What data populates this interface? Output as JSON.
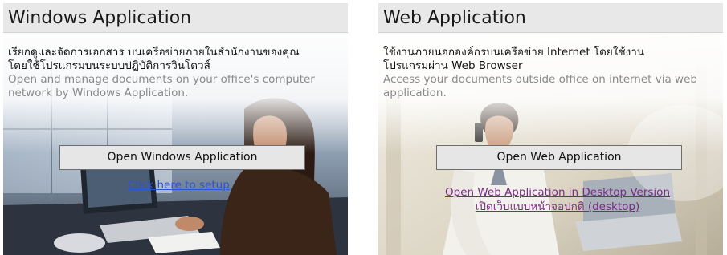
{
  "windows_panel": {
    "title": "Windows Application",
    "desc_th_1": "เรียกดูและจัดการเอกสาร บนเครือข่ายภายในสำนักงานของคุณ",
    "desc_th_2": "โดยใช้โปรแกรมบนระบบปฏิบัติการวินโดวส์",
    "desc_en": "Open and manage documents on your office's computer network by Windows Application.",
    "button_label": "Open Windows Application",
    "setup_link": "Click here to setup"
  },
  "web_panel": {
    "title": "Web Application",
    "desc_th_1": "ใช้งานภายนอกองค์กรบนเครือข่าย Internet โดยใช้งาน",
    "desc_th_2": "โปรแกรมผ่าน Web Browser",
    "desc_en": "Access your documents outside office on internet via web application.",
    "button_label": "Open Web Application",
    "desktop_link_1": "Open Web Application in Desktop Version",
    "desktop_link_2": "เปิดเว็บแบบหน้าจอปกติ (desktop)"
  },
  "colors": {
    "header_bg": "#e8e8e8",
    "link_blue": "#2a55d6",
    "link_visited": "#7a2a88",
    "desc_en": "#8a8a8a"
  }
}
